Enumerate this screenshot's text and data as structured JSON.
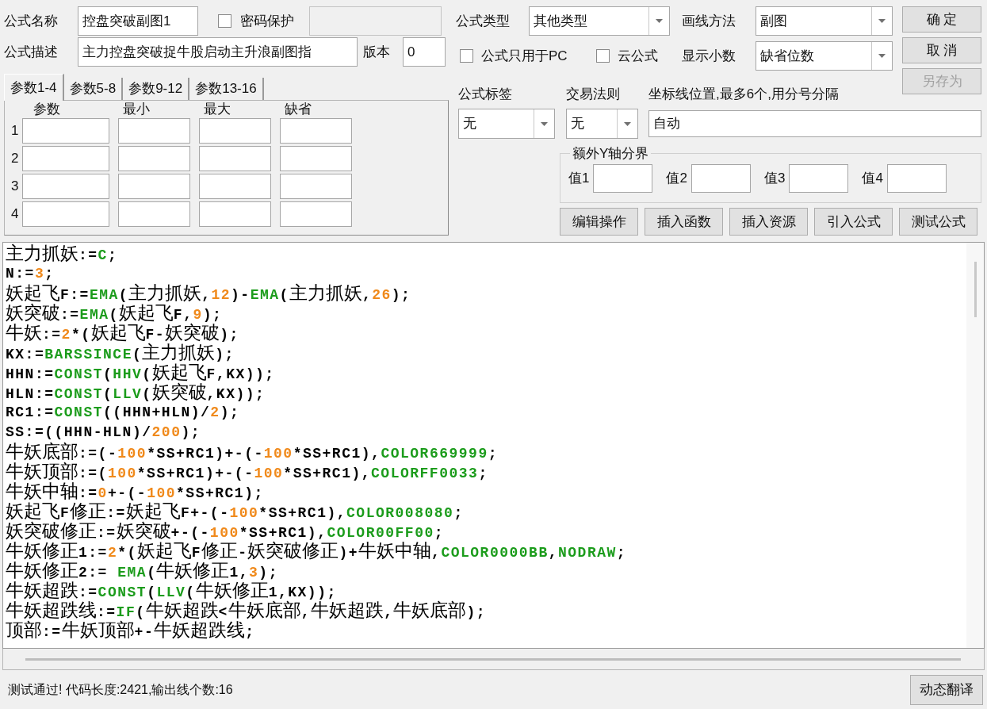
{
  "formula_name": {
    "label": "公式名称",
    "value": "控盘突破副图1"
  },
  "password": {
    "label": "密码保护",
    "checked": false
  },
  "password_field": {
    "disabled": true
  },
  "description": {
    "label": "公式描述",
    "value": "主力控盘突破捉牛股启动主升浪副图指"
  },
  "version": {
    "label": "版本",
    "value": "0"
  },
  "param_tabs": [
    {
      "label": "参数1-4",
      "selected": true
    },
    {
      "label": "参数5-8",
      "selected": false
    },
    {
      "label": "参数9-12",
      "selected": false
    },
    {
      "label": "参数13-16",
      "selected": false
    }
  ],
  "param_columns": [
    "参数",
    "最小",
    "最大",
    "缺省"
  ],
  "param_rows": [
    "1",
    "2",
    "3",
    "4"
  ],
  "formula_type": {
    "label": "公式类型",
    "value": "其他类型"
  },
  "draw_method": {
    "label": "画线方法",
    "value": "副图"
  },
  "pc_only": {
    "label": "公式只用于PC",
    "checked": false
  },
  "cloud": {
    "label": "云公式",
    "checked": false
  },
  "decimals": {
    "label": "显示小数",
    "value": "缺省位数"
  },
  "formula_tag": {
    "label": "公式标签",
    "value": "无"
  },
  "trade_rule": {
    "label": "交易法则",
    "value": "无"
  },
  "axis_lines": {
    "label": "坐标线位置,最多6个,用分号分隔",
    "value": "自动"
  },
  "extra_y": {
    "title": "额外Y轴分界",
    "fields": [
      "值1",
      "值2",
      "值3",
      "值4"
    ]
  },
  "side_buttons": [
    {
      "label": "确 定",
      "disabled": false
    },
    {
      "label": "取 消",
      "disabled": false
    },
    {
      "label": "另存为",
      "disabled": true
    }
  ],
  "tool_buttons": [
    "编辑操作",
    "插入函数",
    "插入资源",
    "引入公式",
    "测试公式"
  ],
  "code_lines": [
    [
      {
        "kind": "text",
        "text": "主力抓妖:="
      },
      {
        "kind": "func",
        "text": "C"
      },
      {
        "kind": "text",
        "text": ";"
      }
    ],
    [
      {
        "kind": "text",
        "text": "N:="
      },
      {
        "kind": "num",
        "text": "3"
      },
      {
        "kind": "text",
        "text": ";"
      }
    ],
    [
      {
        "kind": "text",
        "text": "妖起飞F:="
      },
      {
        "kind": "func",
        "text": "EMA"
      },
      {
        "kind": "text",
        "text": "(主力抓妖,"
      },
      {
        "kind": "num",
        "text": "12"
      },
      {
        "kind": "text",
        "text": ")-"
      },
      {
        "kind": "func",
        "text": "EMA"
      },
      {
        "kind": "text",
        "text": "(主力抓妖,"
      },
      {
        "kind": "num",
        "text": "26"
      },
      {
        "kind": "text",
        "text": ");"
      }
    ],
    [
      {
        "kind": "text",
        "text": "妖突破:="
      },
      {
        "kind": "func",
        "text": "EMA"
      },
      {
        "kind": "text",
        "text": "(妖起飞F,"
      },
      {
        "kind": "num",
        "text": "9"
      },
      {
        "kind": "text",
        "text": ");"
      }
    ],
    [
      {
        "kind": "text",
        "text": "牛妖:="
      },
      {
        "kind": "num",
        "text": "2"
      },
      {
        "kind": "text",
        "text": "*(妖起飞F-妖突破);"
      }
    ],
    [
      {
        "kind": "text",
        "text": "KX:="
      },
      {
        "kind": "func",
        "text": "BARSSINCE"
      },
      {
        "kind": "text",
        "text": "(主力抓妖);"
      }
    ],
    [
      {
        "kind": "text",
        "text": "HHN:="
      },
      {
        "kind": "func",
        "text": "CONST"
      },
      {
        "kind": "text",
        "text": "("
      },
      {
        "kind": "func",
        "text": "HHV"
      },
      {
        "kind": "text",
        "text": "(妖起飞F,KX));"
      }
    ],
    [
      {
        "kind": "text",
        "text": "HLN:="
      },
      {
        "kind": "func",
        "text": "CONST"
      },
      {
        "kind": "text",
        "text": "("
      },
      {
        "kind": "func",
        "text": "LLV"
      },
      {
        "kind": "text",
        "text": "(妖突破,KX));"
      }
    ],
    [
      {
        "kind": "text",
        "text": "RC1:="
      },
      {
        "kind": "func",
        "text": "CONST"
      },
      {
        "kind": "text",
        "text": "((HHN+HLN)/"
      },
      {
        "kind": "num",
        "text": "2"
      },
      {
        "kind": "text",
        "text": ");"
      }
    ],
    [
      {
        "kind": "text",
        "text": "SS:=((HHN-HLN)/"
      },
      {
        "kind": "num",
        "text": "200"
      },
      {
        "kind": "text",
        "text": ");"
      }
    ],
    [
      {
        "kind": "text",
        "text": "牛妖底部:=(-"
      },
      {
        "kind": "num",
        "text": "100"
      },
      {
        "kind": "text",
        "text": "*SS+RC1)+-(-"
      },
      {
        "kind": "num",
        "text": "100"
      },
      {
        "kind": "text",
        "text": "*SS+RC1),"
      },
      {
        "kind": "func",
        "text": "COLOR669999"
      },
      {
        "kind": "text",
        "text": ";"
      }
    ],
    [
      {
        "kind": "text",
        "text": "牛妖顶部:=("
      },
      {
        "kind": "num",
        "text": "100"
      },
      {
        "kind": "text",
        "text": "*SS+RC1)+-(-"
      },
      {
        "kind": "num",
        "text": "100"
      },
      {
        "kind": "text",
        "text": "*SS+RC1),"
      },
      {
        "kind": "func",
        "text": "COLORFF0033"
      },
      {
        "kind": "text",
        "text": ";"
      }
    ],
    [
      {
        "kind": "text",
        "text": "牛妖中轴:="
      },
      {
        "kind": "num",
        "text": "0"
      },
      {
        "kind": "text",
        "text": "+-(-"
      },
      {
        "kind": "num",
        "text": "100"
      },
      {
        "kind": "text",
        "text": "*SS+RC1);"
      }
    ],
    [
      {
        "kind": "text",
        "text": "妖起飞F修正:=妖起飞F+-(-"
      },
      {
        "kind": "num",
        "text": "100"
      },
      {
        "kind": "text",
        "text": "*SS+RC1),"
      },
      {
        "kind": "func",
        "text": "COLOR008080"
      },
      {
        "kind": "text",
        "text": ";"
      }
    ],
    [
      {
        "kind": "text",
        "text": "妖突破修正:=妖突破+-(-"
      },
      {
        "kind": "num",
        "text": "100"
      },
      {
        "kind": "text",
        "text": "*SS+RC1),"
      },
      {
        "kind": "func",
        "text": "COLOR00FF00"
      },
      {
        "kind": "text",
        "text": ";"
      }
    ],
    [
      {
        "kind": "text",
        "text": "牛妖修正1:="
      },
      {
        "kind": "num",
        "text": "2"
      },
      {
        "kind": "text",
        "text": "*(妖起飞F修正-妖突破修正)+牛妖中轴,"
      },
      {
        "kind": "func",
        "text": "COLOR0000BB"
      },
      {
        "kind": "text",
        "text": ","
      },
      {
        "kind": "func",
        "text": "NODRAW"
      },
      {
        "kind": "text",
        "text": ";"
      }
    ],
    [
      {
        "kind": "text",
        "text": "牛妖修正2:= "
      },
      {
        "kind": "func",
        "text": "EMA"
      },
      {
        "kind": "text",
        "text": "(牛妖修正1,"
      },
      {
        "kind": "num",
        "text": "3"
      },
      {
        "kind": "text",
        "text": ");"
      }
    ],
    [
      {
        "kind": "text",
        "text": "牛妖超跌:="
      },
      {
        "kind": "func",
        "text": "CONST"
      },
      {
        "kind": "text",
        "text": "("
      },
      {
        "kind": "func",
        "text": "LLV"
      },
      {
        "kind": "text",
        "text": "(牛妖修正1,KX));"
      }
    ],
    [
      {
        "kind": "text",
        "text": "牛妖超跌线:="
      },
      {
        "kind": "func",
        "text": "IF"
      },
      {
        "kind": "text",
        "text": "(牛妖超跌<牛妖底部,牛妖超跌,牛妖底部);"
      }
    ],
    [
      {
        "kind": "text",
        "text": "顶部:=牛妖顶部+-牛妖超跌线;"
      }
    ]
  ],
  "status": {
    "message": "测试通过! 代码长度:2421,输出线个数:16",
    "button": "动态翻译"
  }
}
